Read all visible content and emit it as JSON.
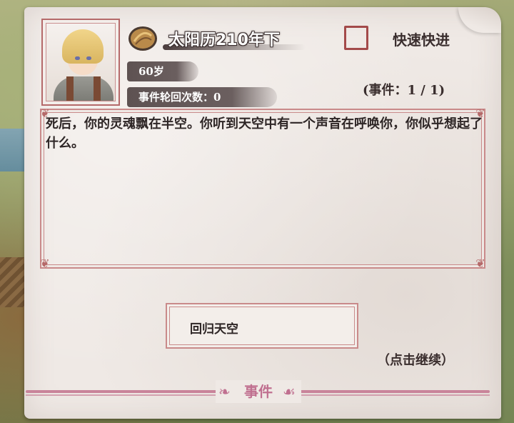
{
  "header": {
    "date": "太阳历210年下",
    "fast_forward_label": "快速快进",
    "age": "60岁",
    "cycles": "事件轮回次数：0",
    "event_counter": "(事件：1 / 1)"
  },
  "story": {
    "text": "死后，你的灵魂飘在半空。你听到天空中有一个声音在呼唤你，你似乎想起了什么。"
  },
  "choices": [
    {
      "label": "回归天空"
    }
  ],
  "continue_label": "（点击继续）",
  "footer": {
    "title": "事件"
  },
  "icons": {
    "portrait": "character-portrait",
    "coin": "bread-coin-icon",
    "checkbox": "checkbox-icon"
  },
  "colors": {
    "paper": "#efe9e5",
    "frame": "#c98a8a",
    "text": "#2e2626",
    "accent_pink": "#c07090",
    "pill": "#5e5252"
  }
}
